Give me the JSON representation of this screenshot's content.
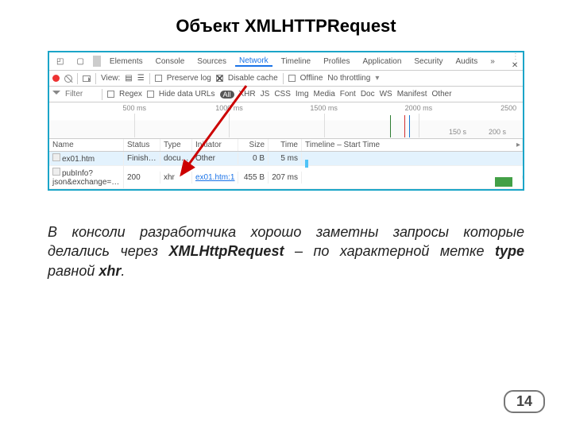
{
  "title": "Объект XMLHTTPRequest",
  "devtools": {
    "tabs": [
      "Elements",
      "Console",
      "Sources",
      "Network",
      "Timeline",
      "Profiles",
      "Application",
      "Security",
      "Audits"
    ],
    "active_tab": "Network",
    "more": "»",
    "toolbar": {
      "view_label": "View:",
      "preserve": "Preserve log",
      "disable": "Disable cache",
      "offline": "Offline",
      "throttle": "No throttling"
    },
    "filter": {
      "placeholder": "Filter",
      "regex": "Regex",
      "hide": "Hide data URLs",
      "all": "All",
      "types": [
        "XHR",
        "JS",
        "CSS",
        "Img",
        "Media",
        "Font",
        "Doc",
        "WS",
        "Manifest",
        "Other"
      ]
    },
    "timeline_ticks": [
      "500 ms",
      "1000 ms",
      "1500 ms",
      "2000 ms",
      "2500"
    ],
    "table": {
      "headers": [
        "Name",
        "Status",
        "Type",
        "Initiator",
        "Size",
        "Time",
        "Timeline – Start Time"
      ],
      "tl_ticks": [
        "150 s",
        "200 s"
      ],
      "rows": [
        {
          "name": "ex01.htm",
          "status": "Finish…",
          "type": "docu…",
          "initiator": "Other",
          "size": "0 B",
          "time": "5 ms",
          "bar": "small"
        },
        {
          "name": "pubInfo?json&exchange=…",
          "status": "200",
          "type": "xhr",
          "initiator": "ex01.htm:1",
          "initiator_link": true,
          "size": "455 B",
          "time": "207 ms",
          "bar": "green"
        }
      ]
    }
  },
  "body": {
    "t1": "В консоли разработчика хорошо заметны запросы которые делались через ",
    "b1": "XMLHttpRequest",
    "t2": " – по характерной метке ",
    "b2": "type",
    "t3": " равной ",
    "b3": "xhr",
    "t4": "."
  },
  "page": "14"
}
